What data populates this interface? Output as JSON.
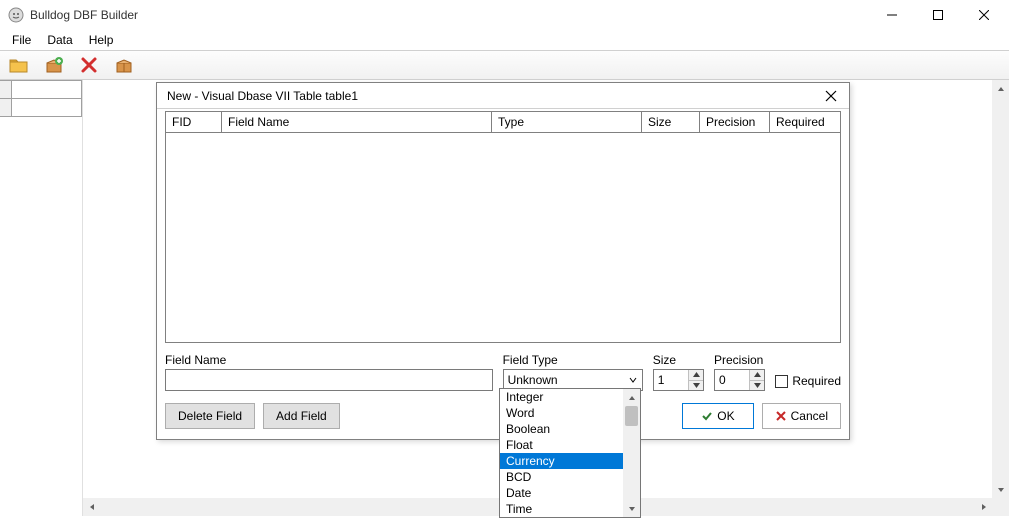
{
  "app": {
    "title": "Bulldog DBF Builder"
  },
  "menu": {
    "items": [
      "File",
      "Data",
      "Help"
    ]
  },
  "toolbar": {
    "icons": [
      "open-folder-icon",
      "add-to-box-icon",
      "delete-x-icon",
      "box-icon"
    ]
  },
  "dialog": {
    "title": "New - Visual Dbase VII Table table1",
    "columns": {
      "fid": "FID",
      "fieldname": "Field Name",
      "type": "Type",
      "size": "Size",
      "precision": "Precision",
      "required": "Required"
    },
    "labels": {
      "fieldname": "Field Name",
      "fieldtype": "Field Type",
      "size": "Size",
      "precision": "Precision",
      "required": "Required"
    },
    "values": {
      "fieldname": "",
      "fieldtype": "Unknown",
      "size": "1",
      "precision": "0",
      "required": false
    },
    "buttons": {
      "delete": "Delete Field",
      "add": "Add Field",
      "ok": "OK",
      "cancel": "Cancel"
    }
  },
  "dropdown": {
    "options": [
      "Integer",
      "Word",
      "Boolean",
      "Float",
      "Currency",
      "BCD",
      "Date",
      "Time"
    ],
    "highlighted": "Currency"
  }
}
